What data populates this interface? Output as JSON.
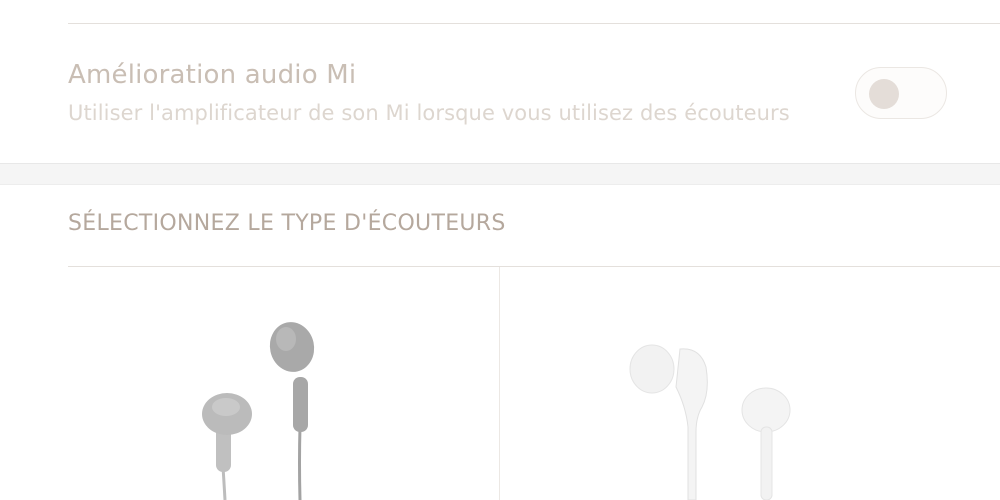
{
  "audio_enhancement": {
    "title": "Amélioration audio Mi",
    "subtitle": "Utiliser l'amplificateur de son Mi lorsque vous utilisez des écouteurs",
    "toggle_on": false
  },
  "headphone_type": {
    "header": "SÉLECTIONNEZ LE TYPE D'ÉCOUTEURS",
    "options": [
      {
        "icon": "earbuds-icon",
        "selected": false
      },
      {
        "icon": "in-ear-headphones-icon",
        "selected": false
      }
    ]
  }
}
